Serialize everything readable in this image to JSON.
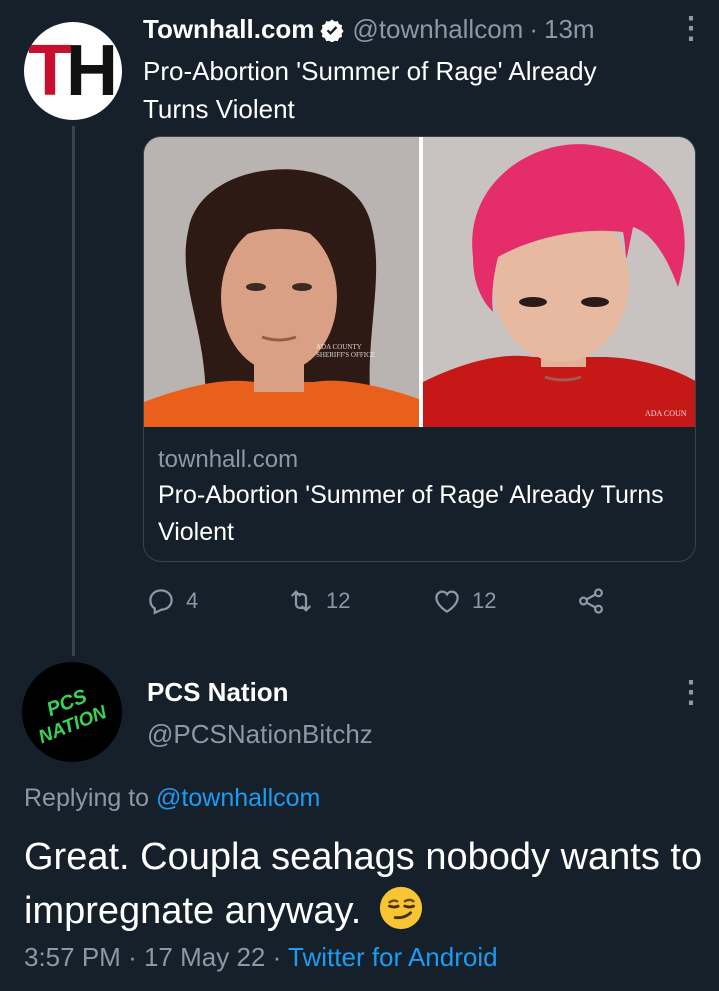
{
  "tweet": {
    "author_name": "Townhall.com",
    "author_handle": "@townhallcom",
    "separator": "·",
    "time_ago": "13m",
    "avatar_initials": {
      "first": "T",
      "second": "H"
    },
    "text": "Pro-Abortion 'Summer of Rage' Already Turns Violent",
    "card": {
      "domain": "townhall.com",
      "title": "Pro-Abortion 'Summer of Rage' Already Turns Violent",
      "photo_left_watermark": "ADA COUNTY SHERIFF'S OFFICE",
      "photo_right_watermark": "ADA COUN"
    },
    "actions": {
      "reply_count": "4",
      "retweet_count": "12",
      "like_count": "12"
    }
  },
  "reply": {
    "author_name": "PCS Nation",
    "author_handle": "@PCSNationBitchz",
    "avatar_text_line1": "PCS",
    "avatar_text_line2": "NATION",
    "replying_prefix": "Replying to",
    "replying_to": "@townhallcom",
    "text": "Great. Coupla seahags nobody wants to impregnate anyway.",
    "time": "3:57 PM",
    "date": "17 May 22",
    "separator": "·",
    "source": "Twitter for Android"
  },
  "colors": {
    "background": "#15202b",
    "secondary_text": "#8b98a5",
    "link": "#1d9bf0",
    "border": "#38444d",
    "avatar_pcs_text": "#39d353"
  },
  "icons": {
    "verified": "verified-badge-icon",
    "more": "more-vertical-icon",
    "reply": "reply-icon",
    "retweet": "retweet-icon",
    "like": "heart-icon",
    "share": "share-icon",
    "emoji": "smirking-face-emoji"
  }
}
